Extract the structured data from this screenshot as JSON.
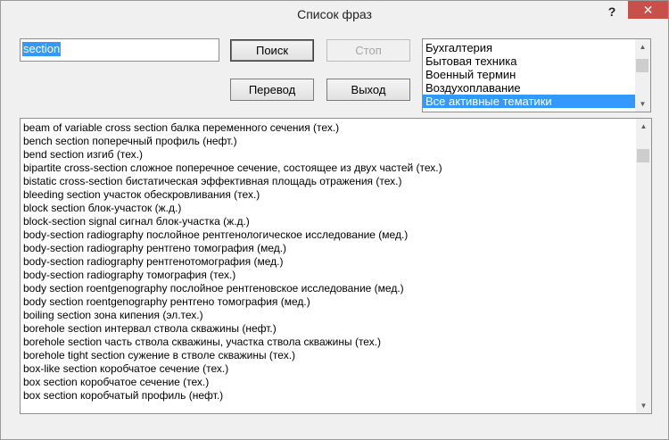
{
  "window": {
    "title": "Список фраз",
    "help_glyph": "?",
    "close_glyph": "✕"
  },
  "search": {
    "value": "section"
  },
  "buttons": {
    "search": "Поиск",
    "stop": "Стоп",
    "translate": "Перевод",
    "exit": "Выход"
  },
  "topics": {
    "items": [
      "Бухгалтерия",
      "Бытовая техника",
      "Военный термин",
      "Воздухоплавание",
      "Все активные тематики"
    ],
    "selected_index": 4
  },
  "scroll": {
    "up": "▲",
    "down": "▼"
  },
  "results": [
    "beam of variable cross section балка переменного сечения (тех.)",
    "bench section поперечный профиль (нефт.)",
    "bend section изгиб (тех.)",
    "bipartite cross-section сложное поперечное сечение, состоящее из двух частей (тех.)",
    "bistatic cross-section бистатическая эффективная площадь отражения (тех.)",
    "bleeding section участок обескровливания (тех.)",
    "block section блок-участок (ж.д.)",
    "block-section signal сигнал блок-участка (ж.д.)",
    "body-section radiography послойное рентгенологическое исследование (мед.)",
    "body-section radiography рентгено томография (мед.)",
    "body-section radiography рентгенотомография (мед.)",
    "body-section radiography томография (тех.)",
    "body section roentgenography послойное рентгеновское исследование (мед.)",
    "body section roentgenography рентгено томография (мед.)",
    "boiling section зона кипения (эл.тех.)",
    "borehole section интервал ствола скважины (нефт.)",
    "borehole section часть ствола скважины, участка ствола скважины (тех.)",
    "borehole tight section сужение в стволе скважины (тех.)",
    "box-like section коробчатое сечение (тех.)",
    "box section коробчатое сечение (тех.)",
    "box section коробчатый профиль (нефт.)"
  ]
}
